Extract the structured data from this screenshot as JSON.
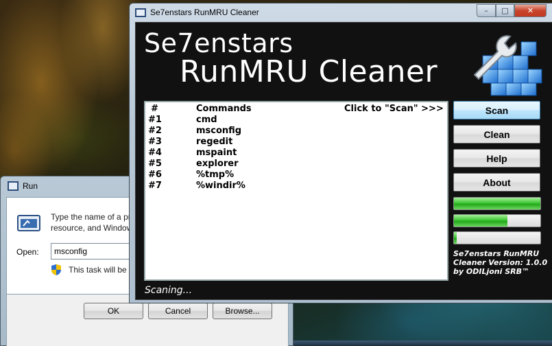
{
  "run_dialog": {
    "title": "Run",
    "description_line1": "Type the name of a pr",
    "description_line2": "resource, and Window",
    "open_label": "Open:",
    "open_value": "msconfig",
    "admin_note": "This task will be c",
    "buttons": {
      "ok": "OK",
      "cancel": "Cancel",
      "browse": "Browse..."
    }
  },
  "cleaner": {
    "window_title": "Se7enstars RunMRU Cleaner",
    "window_controls": {
      "minimize": "–",
      "maximize": "□",
      "close": "✕"
    },
    "brand_line1": "Se7enstars",
    "brand_line2": "RunMRU Cleaner",
    "list": {
      "header_num": "#",
      "header_commands": "Commands",
      "header_hint": "Click to \"Scan\" >>>",
      "rows": [
        {
          "num": "#1",
          "cmd": "cmd"
        },
        {
          "num": "#2",
          "cmd": "msconfig"
        },
        {
          "num": "#3",
          "cmd": "regedit"
        },
        {
          "num": "#4",
          "cmd": "mspaint"
        },
        {
          "num": "#5",
          "cmd": "explorer"
        },
        {
          "num": "#6",
          "cmd": "%tmp%"
        },
        {
          "num": "#7",
          "cmd": "%windir%"
        }
      ]
    },
    "buttons": {
      "scan": "Scan",
      "clean": "Clean",
      "help": "Help",
      "about": "About"
    },
    "progress": [
      1.0,
      0.62,
      0.03
    ],
    "version_text": "Se7enstars RunMRU\nCleaner Version: 1.0.0\nby ODILjoni SRB™",
    "status": "Scaning..."
  },
  "colors": {
    "accent_progress": "#3fc735",
    "client_background": "#111111",
    "scan_button_highlight": "#bee6fd"
  }
}
